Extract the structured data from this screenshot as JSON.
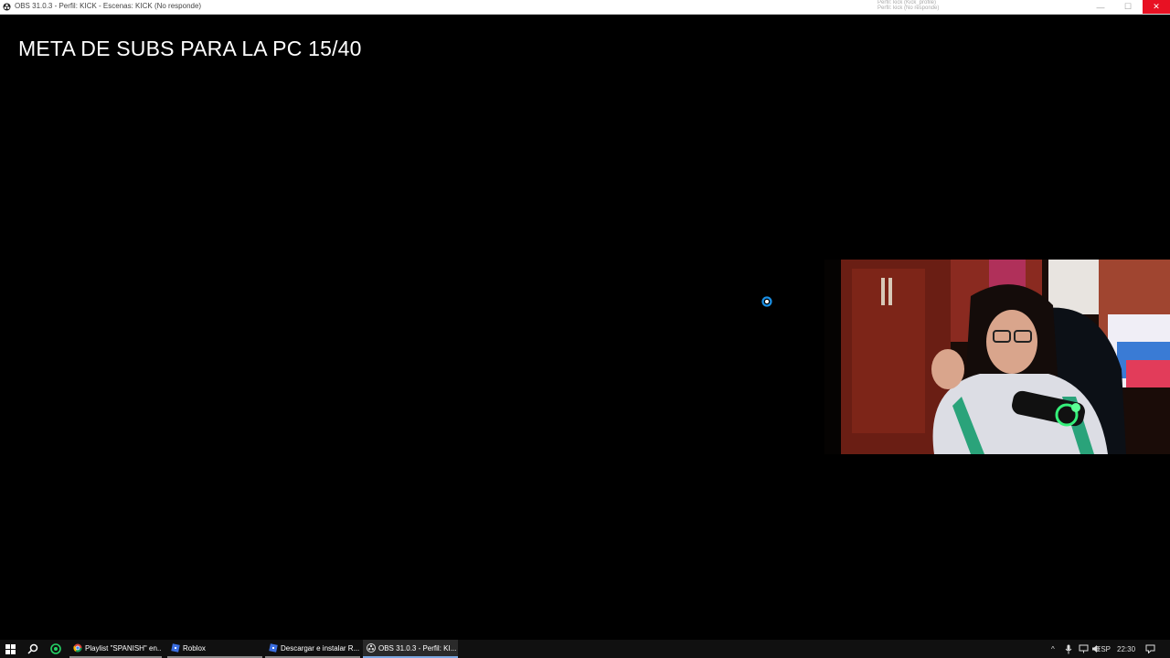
{
  "window": {
    "title": "OBS 31.0.3 - Perfil: KICK - Escenas: KICK (No responde)",
    "overlay_notes": [
      "Perfil: kick (Kick_profile)",
      "Perfil: kick (No responde)"
    ],
    "controls": {
      "minimize": "—",
      "maximize": "☐",
      "close": "✕"
    }
  },
  "canvas": {
    "goal_text": "META DE SUBS PARA LA PC 15/40",
    "webcam_label": "webcam-feed"
  },
  "taskbar": {
    "apps": [
      {
        "label": "Playlist \"SPANISH\" en...",
        "icon": "chrome-icon",
        "state": "open"
      },
      {
        "label": "Roblox",
        "icon": "roblox-icon",
        "state": "open"
      },
      {
        "label": "Descargar e instalar R...",
        "icon": "roblox-icon",
        "state": "open"
      },
      {
        "label": "OBS 31.0.3 - Perfil: KI...",
        "icon": "obs-icon",
        "state": "active"
      }
    ],
    "language": "ESP",
    "time": "22:30"
  },
  "colors": {
    "close_button": "#e81123",
    "taskbar": "#101010",
    "busy_cursor": "#1a8fe3"
  }
}
